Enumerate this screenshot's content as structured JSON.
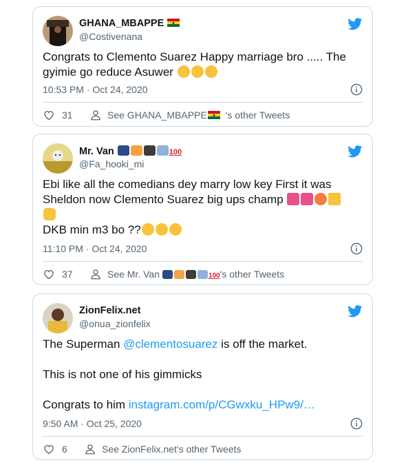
{
  "tweets": [
    {
      "name": "GHANA_MBAPPE",
      "handle": "@Costivenana",
      "text_lines": [
        "Congrats to Clemento Suarez Happy marriage bro ..... The",
        "gyimie go reduce Asuwer"
      ],
      "time": "10:53 PM · Oct 24, 2020",
      "likes": "31",
      "see_other_prefix": "See GHANA_MBAPPE",
      "see_other_suffix": "'s other Tweets"
    },
    {
      "name": "Mr. Van",
      "handle": "@Fa_hooki_mi",
      "text_lines": [
        "Ebi like all the comedians dey marry low key First it was",
        "Sheldon now Clemento Suarez big ups champ",
        "",
        "DKB min m3 bo ??"
      ],
      "time": "11:10 PM · Oct 24, 2020",
      "likes": "37",
      "see_other_prefix": "See Mr. Van",
      "see_other_suffix": "'s other Tweets",
      "name_emoji_text": "100"
    },
    {
      "name": "ZionFelix.net",
      "handle": "@onua_zionfelix",
      "text_pre_link": "The Superman ",
      "mention": "@clementosuarez",
      "text_post_link": " is off the market.",
      "line2": "This is not one of his gimmicks",
      "line3_pre": "Congrats to him ",
      "url": "instagram.com/p/CGwxku_HPw9/…",
      "time": "9:50 AM · Oct 25, 2020",
      "likes": "6",
      "see_other": "See ZionFelix.net's other Tweets"
    }
  ],
  "colors": {
    "brand_blue": "#1d9bf0",
    "text": "#0f1419",
    "secondary": "#536471",
    "border": "#cfd9de"
  },
  "icons": [
    "twitter-bird-icon",
    "heart-icon",
    "user-icon",
    "info-icon",
    "ghana-flag-icon"
  ]
}
